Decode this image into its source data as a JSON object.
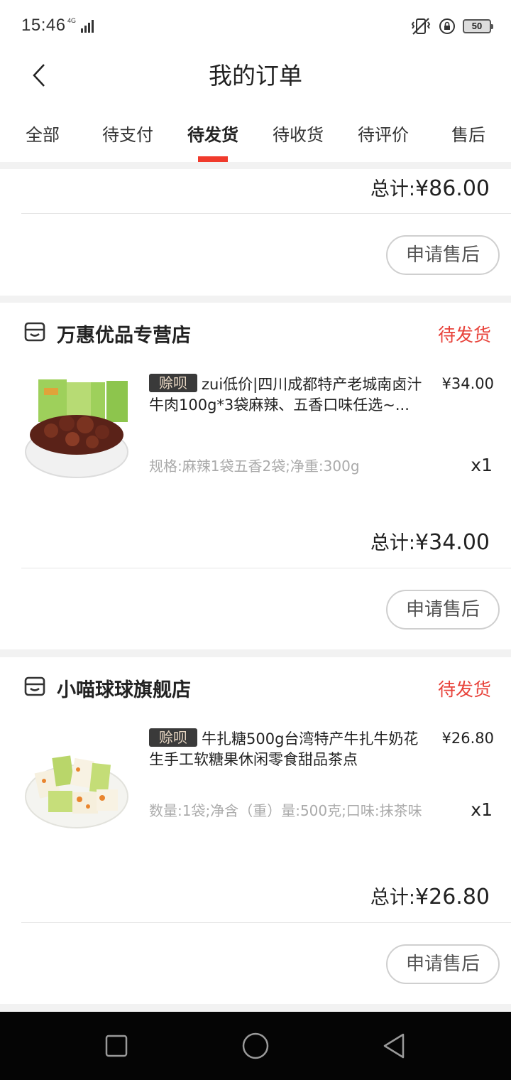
{
  "status_bar": {
    "time": "15:46",
    "network": "4G",
    "battery": "50"
  },
  "header": {
    "title": "我的订单"
  },
  "tabs": [
    "全部",
    "待支付",
    "待发货",
    "待收货",
    "待评价",
    "售后"
  ],
  "active_tab": "待发货",
  "orders": [
    {
      "total_label": "总计:",
      "total_amount": "¥86.00",
      "action": "申请售后"
    },
    {
      "store": "万惠优品专营店",
      "status": "待发货",
      "badge": "赊呗",
      "title": "zui低价|四川成都特产老城南卤汁牛肉100g*3袋麻辣、五香口味任选~...",
      "price": "¥34.00",
      "spec": "规格:麻辣1袋五香2袋;净重:300g",
      "qty": "x1",
      "total_label": "总计:",
      "total_amount": "¥34.00",
      "action": "申请售后"
    },
    {
      "store": "小喵球球旗舰店",
      "status": "待发货",
      "badge": "赊呗",
      "title": "牛扎糖500g台湾特产牛扎牛奶花生手工软糖果休闲零食甜品茶点",
      "price": "¥26.80",
      "spec": "数量:1袋;净含（重）量:500克;口味:抹茶味",
      "qty": "x1",
      "total_label": "总计:",
      "total_amount": "¥26.80",
      "action": "申请售后"
    }
  ],
  "colors": {
    "accent": "#f03a2c",
    "status": "#e8423a"
  },
  "icons": {
    "back": "chevron-left-icon",
    "store": "store-icon",
    "nav_recent": "square-icon",
    "nav_home": "circle-icon",
    "nav_back": "triangle-back-icon"
  }
}
